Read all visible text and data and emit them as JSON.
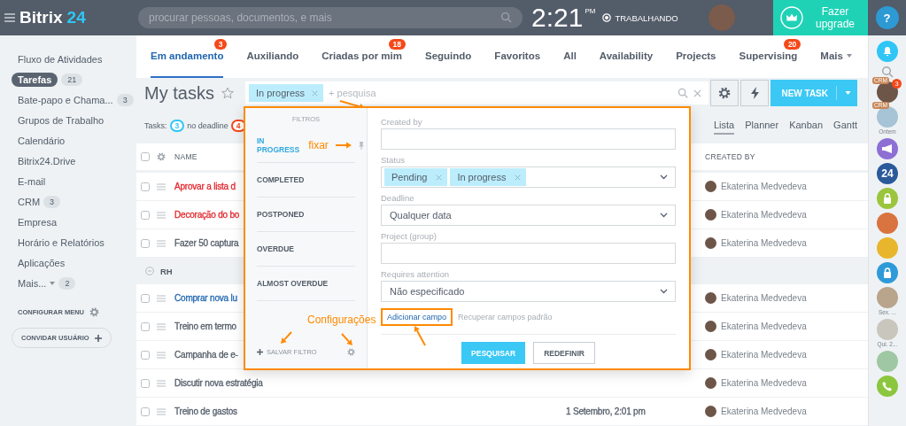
{
  "topbar": {
    "logo": "Bitrix",
    "logo_number": "24",
    "search_placeholder": "procurar pessoas, documentos, e mais",
    "time": "2:21",
    "period": "PM",
    "status": "TRABALHANDO",
    "upgrade": "Fazer upgrade",
    "help": "?"
  },
  "sidebar": {
    "items": [
      {
        "kind": "link",
        "label": "Fluxo de Atividades",
        "selected": false
      },
      {
        "kind": "link",
        "label": "Tarefas",
        "count": "21",
        "selected": true
      },
      {
        "kind": "link",
        "label": "Bate-papo e Chama...",
        "count": "3",
        "selected": false
      },
      {
        "kind": "link",
        "label": "Grupos de Trabalho",
        "selected": false
      },
      {
        "kind": "link",
        "label": "Calendário",
        "selected": false
      },
      {
        "kind": "link",
        "label": "Bitrix24.Drive",
        "selected": false
      },
      {
        "kind": "link",
        "label": "E-mail",
        "selected": false
      },
      {
        "kind": "link",
        "label": "CRM",
        "count": "3",
        "selected": false
      },
      {
        "kind": "link",
        "label": "Empresa",
        "selected": false
      },
      {
        "kind": "link",
        "label": "Horário e Relatórios",
        "selected": false
      },
      {
        "kind": "link",
        "label": "Aplicações",
        "selected": false
      },
      {
        "kind": "more",
        "label": "Mais...",
        "count": "2",
        "selected": false
      }
    ],
    "configure": "CONFIGURAR MENU",
    "invite": "CONVIDAR USUÁRIO"
  },
  "tabs": [
    {
      "label": "Em andamento",
      "badge": "3",
      "selected": true
    },
    {
      "label": "Auxiliando",
      "selected": false
    },
    {
      "label": "Criadas por mim",
      "badge": "18",
      "selected": false
    },
    {
      "label": "Seguindo",
      "selected": false
    },
    {
      "label": "Favoritos",
      "selected": false
    },
    {
      "label": "All",
      "selected": false
    },
    {
      "label": "Availability",
      "selected": false
    },
    {
      "label": "Projects",
      "selected": false
    },
    {
      "label": "Supervising",
      "badge": "20",
      "selected": false
    },
    {
      "label": "Mais",
      "selected": false
    }
  ],
  "header": {
    "title": "My tasks",
    "filter_chip": "In progress",
    "search_placeholder": "+ pesquisa",
    "new_task": "NEW TASK"
  },
  "counters": {
    "label": "Tasks:",
    "items": [
      {
        "count": "3",
        "text": "no deadline",
        "color": "#2fc6f6"
      },
      {
        "count": "4",
        "color": "#f54819"
      }
    ]
  },
  "views": [
    {
      "label": "Lista",
      "selected": true
    },
    {
      "label": "Planner",
      "selected": false
    },
    {
      "label": "Kanban",
      "selected": false
    },
    {
      "label": "Gantt",
      "selected": false
    }
  ],
  "table": {
    "select_all": {
      "checked": false
    },
    "columns": [
      {
        "kind": "name",
        "label": "NAME"
      },
      {
        "kind": "creator",
        "label": "CREATED BY"
      }
    ],
    "rows": [
      {
        "kind": "task",
        "name": "Aprovar a lista d",
        "checked": false,
        "color": "#e0282e",
        "created_by": "Ekaterina Medvedeva"
      },
      {
        "kind": "task",
        "name": "Decoração do bo",
        "checked": false,
        "color": "#e0282e",
        "created_by": "Ekaterina Medvedeva"
      },
      {
        "kind": "task",
        "name": "Fazer 50 captura",
        "checked": false,
        "color": "#535c69",
        "created_by": "Ekaterina Medvedeva"
      },
      {
        "kind": "group",
        "name": "RH"
      },
      {
        "kind": "task",
        "name": "Comprar nova lu",
        "checked": false,
        "color": "#2067b0",
        "created_by": "Ekaterina Medvedeva"
      },
      {
        "kind": "task",
        "name": "Treino em termo",
        "checked": false,
        "color": "#535c69",
        "created_by": "Ekaterina Medvedeva"
      },
      {
        "kind": "task",
        "name": "Campanha de e-",
        "checked": false,
        "color": "#535c69",
        "created_by": "Ekaterina Medvedeva"
      },
      {
        "kind": "task",
        "name": "Discutir nova estratégia",
        "checked": false,
        "color": "#535c69",
        "created_by": "Ekaterina Medvedeva"
      },
      {
        "kind": "task",
        "name": "Treino de gastos",
        "checked": false,
        "color": "#535c69",
        "deadline": "1 Setembro, 2:01 pm",
        "created_by": "Ekaterina Medvedeva"
      }
    ]
  },
  "filter": {
    "title": "FILTROS",
    "presets": [
      {
        "label": "IN PROGRESS",
        "selected": true
      },
      {
        "label": "COMPLETED",
        "selected": false
      },
      {
        "label": "POSTPONED",
        "selected": false
      },
      {
        "label": "OVERDUE",
        "selected": false
      },
      {
        "label": "ALMOST OVERDUE",
        "selected": false
      }
    ],
    "save": "SALVAR FILTRO",
    "fields": [
      {
        "kind": "text",
        "label": "Created by"
      },
      {
        "kind": "tags",
        "label": "Status",
        "tags": [
          "Pending",
          "In progress"
        ]
      },
      {
        "kind": "select",
        "label": "Deadline",
        "value": "Qualquer data"
      },
      {
        "kind": "text",
        "label": "Project (group)"
      },
      {
        "kind": "select",
        "label": "Requires attention",
        "value": "Não especificado"
      }
    ],
    "add_field": "Adicionar campo",
    "restore": "Recuperar campos padrão",
    "search_button": "PESQUISAR",
    "reset_button": "REDEFINIR"
  },
  "annotations": {
    "pin_note": "fixar",
    "settings_note": "Configurações"
  },
  "rightbar": {
    "items": [
      {
        "kind": "bell",
        "color": "#2fc6f6"
      },
      {
        "kind": "search"
      },
      {
        "kind": "avatar",
        "color": "#6d5548",
        "badge": "3",
        "tag": "CRM"
      },
      {
        "kind": "avatar",
        "color": "#a7c3d6",
        "tag": "CRM",
        "caption": "Ontem"
      },
      {
        "kind": "megaphone",
        "color": "#8e6fd4"
      },
      {
        "kind": "number",
        "color": "#2b5a9b",
        "text": "24"
      },
      {
        "kind": "lock",
        "color": "#9bc53d"
      },
      {
        "kind": "avatar",
        "color": "#d9733f"
      },
      {
        "kind": "avatar",
        "color": "#e8b62c"
      },
      {
        "kind": "lock",
        "color": "#2f9ad8"
      },
      {
        "kind": "avatar",
        "color": "#b9a48c",
        "caption": "Sex. ..."
      },
      {
        "kind": "avatar",
        "color": "#c9c6bd",
        "caption": "Qui. 2..."
      },
      {
        "kind": "avatar",
        "color": "#9fc7a4"
      },
      {
        "kind": "phone",
        "color": "#8cc63e"
      }
    ]
  }
}
